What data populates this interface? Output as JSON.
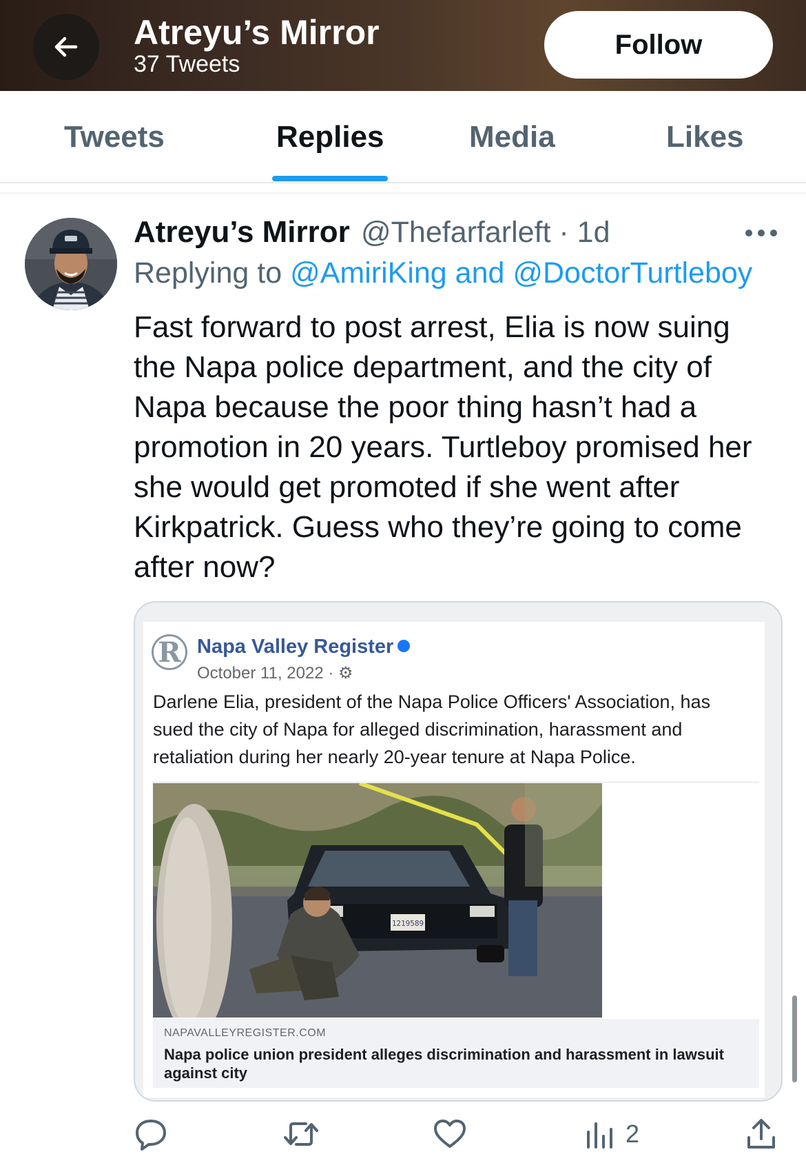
{
  "header": {
    "title": "Atreyu’s Mirror",
    "subtitle": "37 Tweets",
    "follow_label": "Follow"
  },
  "tabs": [
    {
      "label": "Tweets",
      "active": false
    },
    {
      "label": "Replies",
      "active": true
    },
    {
      "label": "Media",
      "active": false
    },
    {
      "label": "Likes",
      "active": false
    }
  ],
  "tweet": {
    "name": "Atreyu’s Mirror",
    "handle_time": "@Thefarfarleft · 1d",
    "replying_prefix": "Replying to ",
    "replying_to": "@AmiriKing and @DoctorTurtleboy",
    "text": "Fast forward to post arrest, Elia is now suing\nthe Napa police department, and the city of\nNapa because the poor thing hasn’t had a\npromotion in 20 years. Turtleboy promised her\nshe would get promoted if she went after\nKirkpatrick. Guess who they’re going to come\nafter now?",
    "embed": {
      "page_name": "Napa Valley Register",
      "date": "October 11, 2022 · ⚙",
      "text": "Darlene Elia, president of the Napa Police Officers' Association, has\nsued the city of Napa for alleged discrimination, harassment and\nretaliation during her nearly 20-year tenure at Napa Police.",
      "plate": "1219589",
      "link_domain": "NAPAVALLEYREGISTER.COM",
      "link_title": "Napa police union president alleges discrimination and harassment in lawsuit against city"
    },
    "actions": {
      "views_count": "2"
    }
  },
  "colors": {
    "accent": "#1d9bf0",
    "text": "#0f1419",
    "secondary": "#536471",
    "fb_blue": "#385898"
  }
}
